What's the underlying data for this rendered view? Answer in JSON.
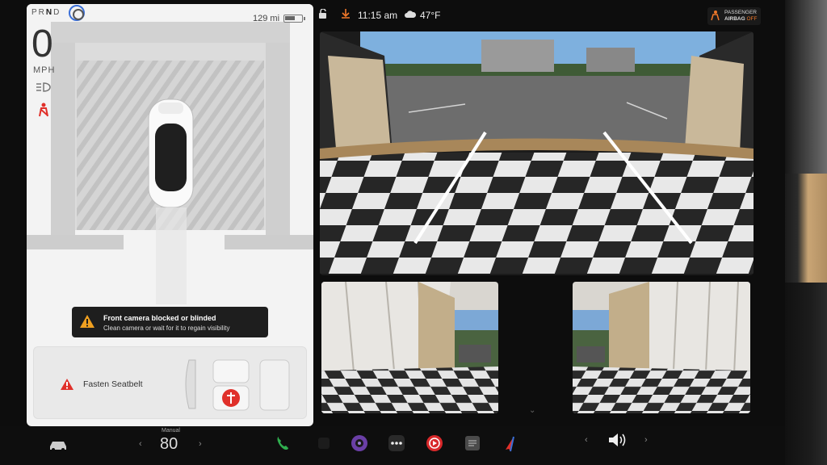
{
  "drive": {
    "gear_prefix": "PR",
    "gear_active": "N",
    "gear_suffix": "D",
    "range": "129 mi",
    "speed": "0",
    "speed_unit": "MPH"
  },
  "alert": {
    "title": "Front camera blocked or blinded",
    "message": "Clean camera or wait for it to regain visibility"
  },
  "seatbelt": {
    "label": "Fasten Seatbelt"
  },
  "status": {
    "time": "11:15 am",
    "temperature": "47°F",
    "airbag_line1": "PASSENGER",
    "airbag_line2_prefix": "AIRBAG ",
    "airbag_line2_state": "OFF"
  },
  "dock": {
    "climate_mode": "Manual",
    "climate_temp": "80",
    "left_arrow": "‹",
    "right_arrow": "›"
  },
  "colors": {
    "accent_blue": "#3a6fd8",
    "warning_red": "#e0302a",
    "airbag_orange": "#f0782a",
    "download_orange": "#f0782a"
  },
  "icons": [
    "lock-icon",
    "download-icon",
    "cloud-icon",
    "steering-wheel-icon",
    "battery-icon",
    "headlight-icon",
    "seatbelt-icon",
    "car-icon",
    "phone-icon",
    "camera-app-icon",
    "dots-icon",
    "media-icon",
    "notes-icon",
    "nav-icon",
    "speaker-icon"
  ]
}
